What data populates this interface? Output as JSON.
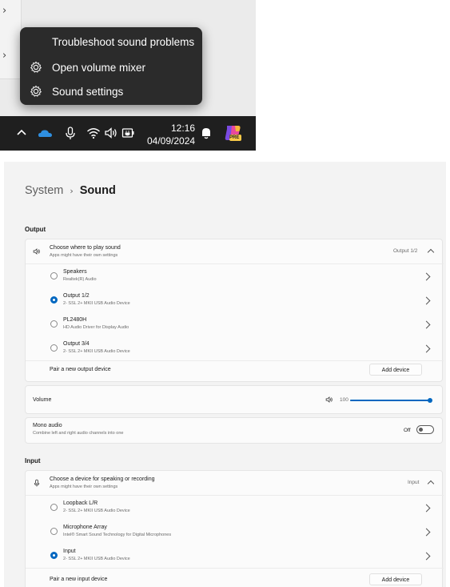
{
  "top_panel": {
    "left_strip_chevrons": [
      "›",
      "›"
    ],
    "context_menu": {
      "items": [
        {
          "label": "Troubleshoot sound problems",
          "icon": null
        },
        {
          "label": "Open volume mixer",
          "icon": "gear-icon"
        },
        {
          "label": "Sound settings",
          "icon": "gear-icon"
        }
      ]
    },
    "taskbar": {
      "time": "12:16",
      "date": "04/09/2024",
      "icons": [
        "chevron-up-icon",
        "onedrive-cloud-icon",
        "microphone-icon",
        "wifi-icon",
        "speaker-icon",
        "battery-plug-icon",
        "bell-icon",
        "copilot-pre-icon"
      ],
      "copilot_badge": "PRE"
    }
  },
  "settings": {
    "breadcrumb": {
      "parent": "System",
      "separator": "›",
      "current": "Sound"
    },
    "output": {
      "section_label": "Output",
      "choose": {
        "title": "Choose where to play sound",
        "subtitle": "Apps might have their own settings",
        "selected_value": "Output 1/2"
      },
      "devices": [
        {
          "name": "Speakers",
          "desc": "Realtek(R) Audio",
          "selected": false
        },
        {
          "name": "Output 1/2",
          "desc": "2- SSL 2+ MKII USB Audio Device",
          "selected": true
        },
        {
          "name": "PL2480H",
          "desc": "HD Audio Driver for Display Audio",
          "selected": false
        },
        {
          "name": "Output 3/4",
          "desc": "2- SSL 2+ MKII USB Audio Device",
          "selected": false
        }
      ],
      "pair": {
        "label": "Pair a new output device",
        "button": "Add device"
      },
      "volume": {
        "label": "Volume",
        "value": "100",
        "level": 1.0
      },
      "mono": {
        "title": "Mono audio",
        "subtitle": "Combine left and right audio channels into one",
        "state": "Off"
      }
    },
    "input": {
      "section_label": "Input",
      "choose": {
        "title": "Choose a device for speaking or recording",
        "subtitle": "Apps might have their own settings",
        "selected_value": "Input"
      },
      "devices": [
        {
          "name": "Loopback L/R",
          "desc": "2- SSL 2+ MKII USB Audio Device",
          "selected": false
        },
        {
          "name": "Microphone Array",
          "desc": "Intel® Smart Sound Technology for Digital Microphones",
          "selected": false
        },
        {
          "name": "Input",
          "desc": "2- SSL 2+ MKII USB Audio Device",
          "selected": true
        }
      ],
      "pair": {
        "label": "Pair a new input device",
        "button": "Add device"
      }
    },
    "colors": {
      "accent": "#0067c0",
      "taskbar": "#1f1f1f",
      "menu": "#2b2b2b"
    }
  }
}
